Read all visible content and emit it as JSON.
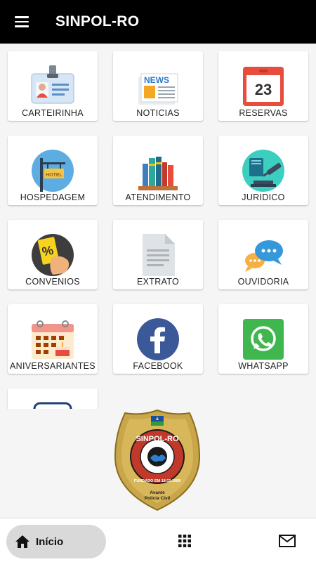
{
  "header": {
    "title": "SINPOL-RO",
    "menu_icon": "menu-icon"
  },
  "tiles": [
    {
      "label": "CARTEIRINHA",
      "icon": "id-card-icon"
    },
    {
      "label": "NOTICIAS",
      "icon": "newspaper-icon"
    },
    {
      "label": "RESERVAS",
      "icon": "calendar-icon"
    },
    {
      "label": "HOSPEDAGEM",
      "icon": "hotel-sign-icon"
    },
    {
      "label": "ATENDIMENTO",
      "icon": "books-icon"
    },
    {
      "label": "JURIDICO",
      "icon": "gavel-law-icon"
    },
    {
      "label": "CONVENIOS",
      "icon": "discount-coupon-icon"
    },
    {
      "label": "EXTRATO",
      "icon": "document-icon"
    },
    {
      "label": "OUVIDORIA",
      "icon": "chat-bubbles-icon"
    },
    {
      "label": "ANIVERSARIANTES",
      "icon": "birthday-calendar-icon"
    },
    {
      "label": "FACEBOOK",
      "icon": "facebook-icon"
    },
    {
      "label": "WHATSAPP",
      "icon": "whatsapp-icon"
    }
  ],
  "calendar_day": "23",
  "news_word": "NEWS",
  "hotel_word": "HOTEL",
  "badge": {
    "title": "SINPOL-RO",
    "founded": "FUNDADO EM 18.02.1988",
    "motto": "Avante",
    "subtitle": "Polícia Civil"
  },
  "bottom_nav": {
    "home_label": "Início",
    "home_icon": "home-icon",
    "apps_icon": "apps-grid-icon",
    "mail_icon": "mail-icon"
  },
  "colors": {
    "appbar": "#000000",
    "background": "#f5f5f5",
    "tile": "#ffffff",
    "facebook": "#3b5998",
    "whatsapp": "#3fb64e",
    "calendar_red": "#e74c3c",
    "badge_gold": "#c9a64a"
  }
}
